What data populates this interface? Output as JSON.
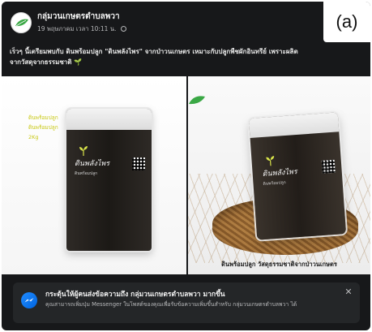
{
  "post": {
    "page_name": "กลุ่มวนเกษตรตำบลพวา",
    "time": "19 พฤษภาคม เวลา 10:11 น.",
    "caption_line1": "เร็วๆ นี้เตรียมพบกับ ดินพร้อมปลูก \"ดินพลังไพร\" จากป่าวนเกษตร เหมาะกับปลูกพืชผักอินทรีย์ เพราะผลิต",
    "caption_line2": "จากวัสดุจากธรรมชาติ",
    "caption_emoji": "🌱"
  },
  "panel_label": "(a)",
  "photos": {
    "left_text_lines": [
      "ดินพร้อมปลูก",
      "ดินพร้อมปลูก",
      "2Kg"
    ],
    "bag_brand": "ดินพลังไพร",
    "bag_sub": "ดินพร้อมปลูก",
    "right_caption": "ดินพร้อมปลูก วัสดุธรรมชาติจากป่าวนเกษตร"
  },
  "banner": {
    "title": "กระตุ้นให้ผู้คนส่งข้อความถึง กลุ่มวนเกษตรตำบลพวา มากขึ้น",
    "body": "คุณสามารถเพิ่มปุ่ม Messenger ในโพสต์ของคุณเพื่อรับข้อความเพิ่มขึ้นสำหรับ กลุ่มวนเกษตรตำบลพวา ได้",
    "close": "✕"
  },
  "colors": {
    "background": "#17181a",
    "messenger": "#1f8bff",
    "accent_green": "#3fc24a"
  }
}
